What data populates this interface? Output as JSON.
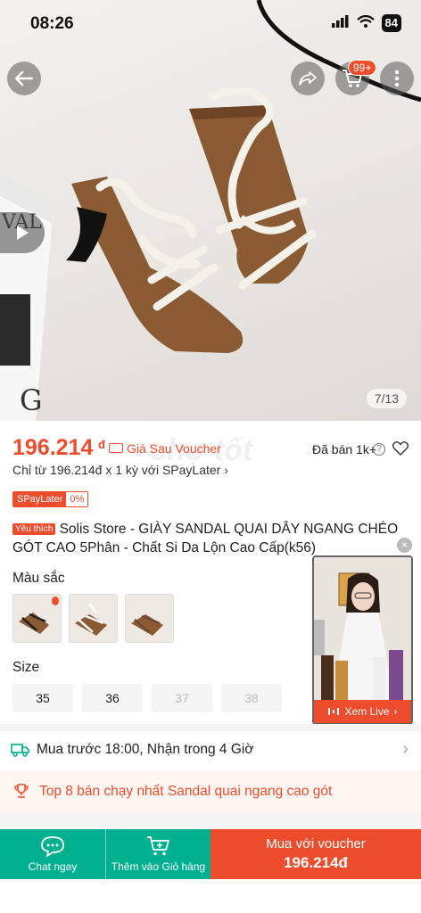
{
  "status_bar": {
    "time": "08:26",
    "battery": "84"
  },
  "header": {
    "cart_badge": "99+"
  },
  "gallery": {
    "counter": "7/13"
  },
  "price": {
    "value": "196.214",
    "currency": "đ",
    "voucher_label": "Giá Sau Voucher",
    "sold": "Đã bán 1k+",
    "installment": "Chỉ từ 196.214đ x 1 kỳ với SPayLater",
    "spay_label": "SPayLater",
    "spay_rate": "0%"
  },
  "product": {
    "tag": "Yêu thích",
    "title": "Solis Store - GIÀY SANDAL QUAI DÂY NGANG CHÉO GÓT CAO 5Phân - Chất Si Da Lộn Cao Cấp(k56)"
  },
  "variants": {
    "color_label": "Màu sắc",
    "size_label": "Size",
    "sizes": [
      "35",
      "36",
      "37",
      "38"
    ]
  },
  "live": {
    "button": "Xem Live"
  },
  "shipping": {
    "text": "Mua trước 18:00, Nhận trong 4 Giờ"
  },
  "ranking": {
    "text": "Top 8 bán chạy nhất Sandal quai ngang cao gót"
  },
  "bottom_bar": {
    "chat": "Chat ngay",
    "add_cart": "Thêm vào Giỏ hàng",
    "buy_label": "Mua với voucher",
    "buy_price": "196.214đ"
  },
  "colors": {
    "accent": "#ee4d2d",
    "teal": "#00b08f",
    "suede": "#8a5a32"
  }
}
